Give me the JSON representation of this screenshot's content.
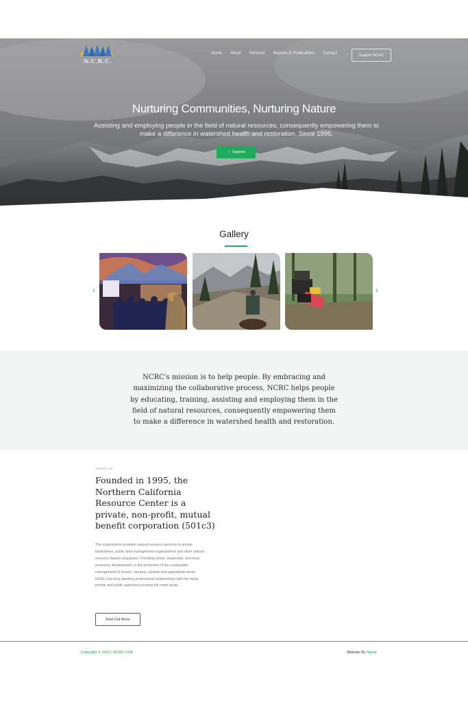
{
  "logo": {
    "text": "N.C.R.C."
  },
  "nav": {
    "items": [
      "Home",
      "About",
      "Services",
      "Reports & Publications",
      "Contact"
    ],
    "cta": "Support NCRC"
  },
  "hero": {
    "title": "Nurturing Communities, Nurturing Nature",
    "subtitle": "Assisting and employing people in the field of natural resources, consequently empowering them to make a difference in watershed health and restoration. Since 1995.",
    "button": "Support"
  },
  "gallery": {
    "title": "Gallery",
    "prev_icon": "chevron-left-icon",
    "next_icon": "chevron-right-icon"
  },
  "mission": {
    "text": "NCRC's mission is to help people. By embracing and maximizing the collaborative process, NCRC helps people by educating, training, assisting and employing them in the field of natural resources, consequently empowering them to make a difference in watershed health and restoration."
  },
  "about": {
    "eyebrow": "ABOUT US",
    "title": "Founded in 1995, the Northern California Resource Center is a private, non-profit, mutual benefit corporation (501c3)",
    "body": "The organization provides natural resource services to private landowners, public land management organizations and other natural resource based companies. Providing vision, leadership, and local economic development, in the promotion of the sustainable management of forests, streams, riparian and agricultural areas. NCRC has long standing professional relationships with the many private and public agencies pursuing the same goals.",
    "button": "Find Out More"
  },
  "footer": {
    "copyright": "Copyright © 2023 | NCRC USA",
    "by_label": "Website By ",
    "by_name": "Name"
  },
  "colors": {
    "accent": "#1faa5c",
    "mission_bg": "#f3f4f4"
  }
}
